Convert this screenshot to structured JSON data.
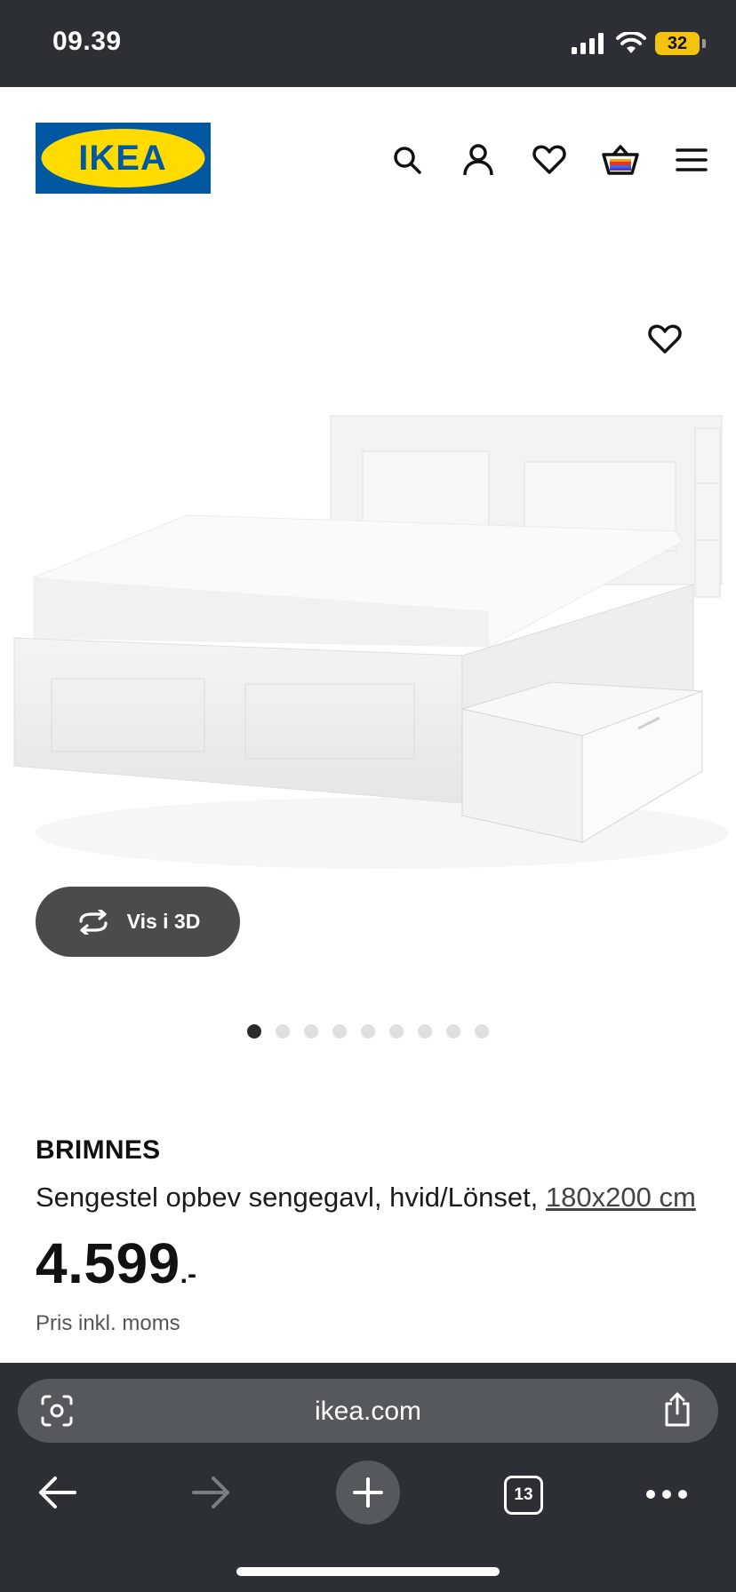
{
  "status_bar": {
    "time": "09.39",
    "battery": "32"
  },
  "header": {
    "logo_text": "IKEA",
    "icons": [
      "search-icon",
      "account-icon",
      "wishlist-icon",
      "basket-icon",
      "menu-icon"
    ],
    "brand_colors": {
      "blue": "#0058a3",
      "yellow": "#ffdb00"
    }
  },
  "gallery": {
    "view_3d_label": "Vis i 3D",
    "image_count": 9,
    "active_index": 0
  },
  "product": {
    "name": "BRIMNES",
    "description": "Sengestel opbev sengegavl, hvid/Lönset, ",
    "size_link": "180x200 cm",
    "price": "4.599",
    "price_suffix": ".-",
    "price_note": "Pris inkl. moms"
  },
  "browser": {
    "url": "ikea.com",
    "tab_count": "13"
  }
}
